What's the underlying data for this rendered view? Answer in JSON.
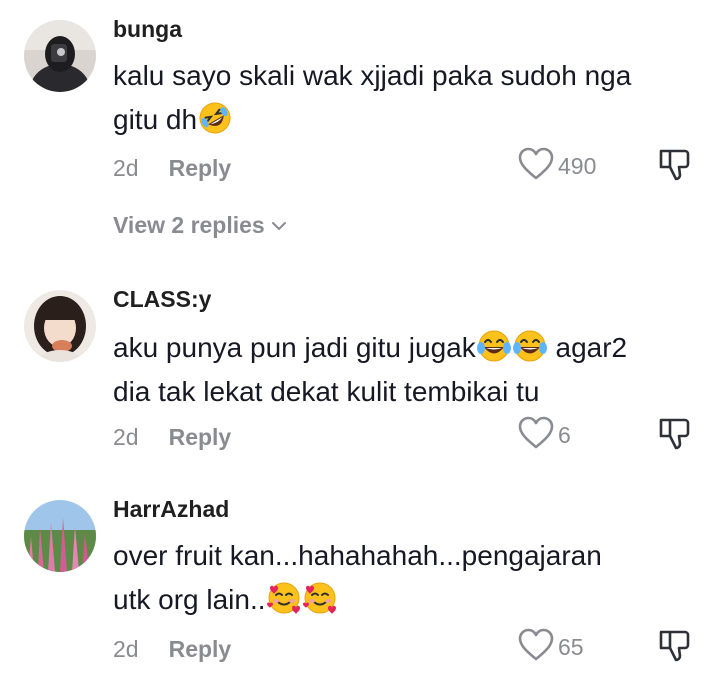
{
  "comments": [
    {
      "username": "bunga",
      "line1": "kalu sayo skali wak xjjadi paka sudoh nga",
      "line2": "gitu dh",
      "emoji_names": [
        "rolling-on-floor-laughing-emoji"
      ],
      "time": "2d",
      "reply_label": "Reply",
      "likes": "490",
      "view_replies": "View 2 replies"
    },
    {
      "username": "CLASS:y",
      "line1_a": "aku punya pun jadi gitu jugak",
      "line1_b": " agar2",
      "line2": "dia tak lekat dekat kulit tembikai tu",
      "emoji_names": [
        "face-with-tears-of-joy-emoji",
        "face-with-tears-of-joy-emoji"
      ],
      "time": "2d",
      "reply_label": "Reply",
      "likes": "6"
    },
    {
      "username": "HarrAzhad",
      "line1": "over fruit kan...hahahahah...pengajaran",
      "line2": "utk org lain..",
      "emoji_names": [
        "smiling-face-with-hearts-emoji",
        "smiling-face-with-hearts-emoji"
      ],
      "time": "2d",
      "reply_label": "Reply",
      "likes": "65"
    }
  ],
  "icons": {
    "like": "heart-outline-icon",
    "dislike": "thumbs-down-icon",
    "expand": "chevron-down-icon"
  },
  "colors": {
    "text": "#161823",
    "muted": "#8a8b91"
  }
}
